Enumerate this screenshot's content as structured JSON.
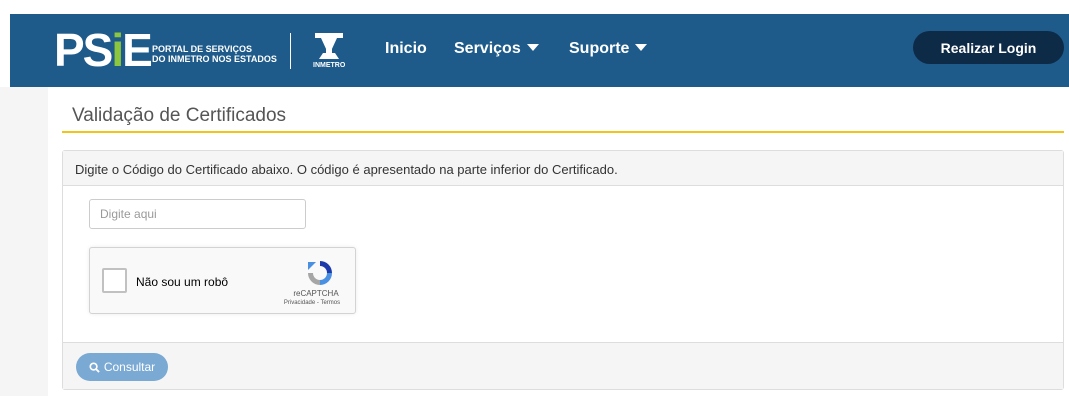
{
  "header": {
    "logo_text_main": "PS",
    "logo_text_i": "i",
    "logo_text_e": "E",
    "logo_subtitle_line1": "PORTAL DE SERVIÇOS",
    "logo_subtitle_line2": "DO INMETRO NOS ESTADOS",
    "inmetro_label": "INMETRO",
    "nav": {
      "inicio": "Inicio",
      "servicos": "Serviços",
      "suporte": "Suporte"
    },
    "login_label": "Realizar Login"
  },
  "page": {
    "title": "Validação de Certificados"
  },
  "panel": {
    "instruction": "Digite o Código do Certificado abaixo. O código é apresentado na parte inferior do Certificado.",
    "input_placeholder": "Digite aqui",
    "input_value": "",
    "recaptcha": {
      "label": "Não sou um robô",
      "brand": "reCAPTCHA",
      "terms": "Privacidade - Termos"
    },
    "consult_label": "Consultar"
  },
  "colors": {
    "header_bg": "#1e5b8a",
    "login_bg": "#0d2a47",
    "title_underline": "#f0c419",
    "consult_bg": "#7aa9d3",
    "logo_accent": "#8cc63f"
  },
  "icons": {
    "nav_caret": "caret-down-icon",
    "consult": "search-icon",
    "recaptcha": "recaptcha-logo-icon",
    "inmetro": "inmetro-logo-icon"
  }
}
